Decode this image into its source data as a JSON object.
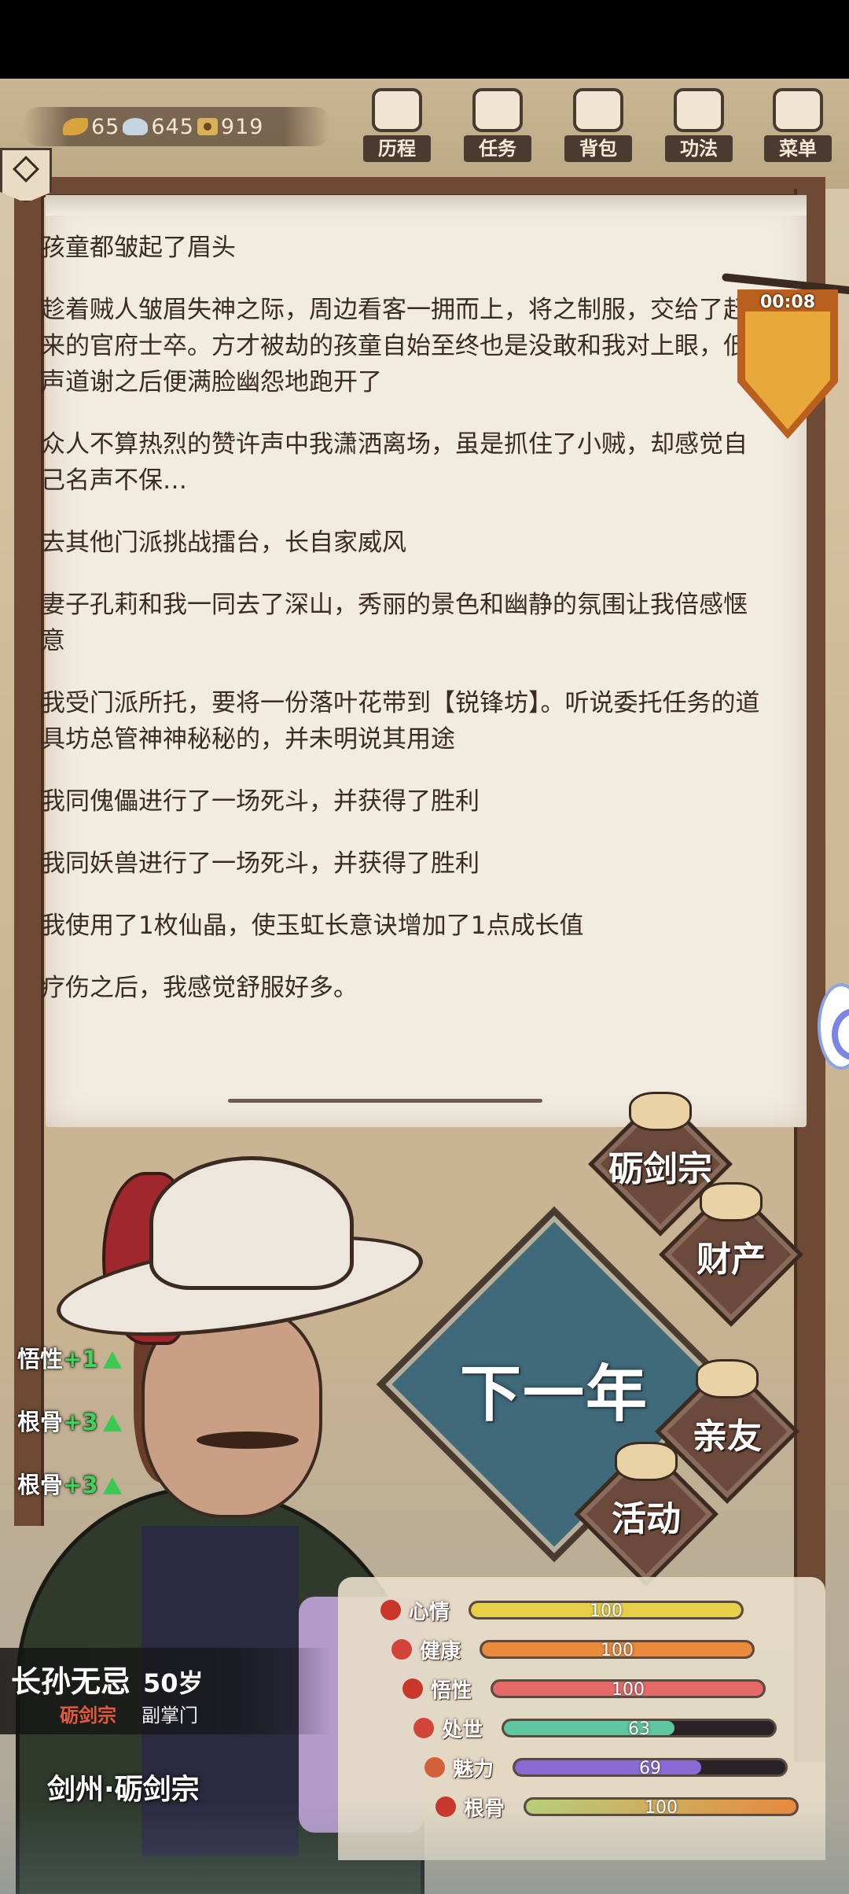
{
  "currency": [
    {
      "icon": "leaf-icon",
      "value": "65"
    },
    {
      "icon": "cloud-icon",
      "value": "645"
    },
    {
      "icon": "coin-icon",
      "value": "919"
    }
  ],
  "menu": [
    {
      "name": "history",
      "label": "历程",
      "icon": "gourd-icon"
    },
    {
      "name": "tasks",
      "label": "任务",
      "icon": "scroll-icon"
    },
    {
      "name": "bag",
      "label": "背包",
      "icon": "bag-icon"
    },
    {
      "name": "skills",
      "label": "功法",
      "icon": "book-icon"
    },
    {
      "name": "menu",
      "label": "菜单",
      "icon": "fan-icon"
    }
  ],
  "timer": "00:08",
  "log": [
    "孩童都皱起了眉头",
    "趁着贼人皱眉失神之际，周边看客一拥而上，将之制服，交给了赶来的官府士卒。方才被劫的孩童自始至终也是没敢和我对上眼，低声道谢之后便满脸幽怨地跑开了",
    "众人不算热烈的赞许声中我潇洒离场，虽是抓住了小贼，却感觉自己名声不保…",
    "去其他门派挑战擂台，长自家威风",
    "妻子孔莉和我一同去了深山，秀丽的景色和幽静的氛围让我倍感惬意",
    "我受门派所托，要将一份落叶花带到【锐锋坊】。听说委托任务的道具坊总管神神秘秘的，并未明说其用途",
    "我同傀儡进行了一场死斗，并获得了胜利",
    "我同妖兽进行了一场死斗，并获得了胜利",
    "我使用了1枚仙晶，使玉虹长意诀增加了1点成长值",
    "疗伤之后，我感觉舒服好多。"
  ],
  "buffs": [
    {
      "name": "悟性",
      "delta": "+1"
    },
    {
      "name": "根骨",
      "delta": "+3"
    },
    {
      "name": "根骨",
      "delta": "+3"
    }
  ],
  "actions": {
    "next_year": "下一年",
    "sect": "砺剑宗",
    "assets": "财产",
    "family": "亲友",
    "activity": "活动"
  },
  "character": {
    "name": "长孙无忌",
    "age": "50岁",
    "sect": "砺剑宗",
    "rank": "副掌门",
    "location": "剑州·砺剑宗"
  },
  "stats": [
    {
      "name": "心情",
      "value": "100",
      "ratio": 1.0,
      "color": "#e6d04a",
      "icon_color": "#c9362a"
    },
    {
      "name": "健康",
      "value": "100",
      "ratio": 1.0,
      "color": "#e98a3c",
      "icon_color": "#d2443a"
    },
    {
      "name": "悟性",
      "value": "100",
      "ratio": 1.0,
      "color": "#e46a6a",
      "icon_color": "#c9362a"
    },
    {
      "name": "处世",
      "value": "63",
      "ratio": 0.63,
      "color": "#5fc7a0",
      "icon_color": "#d2443a"
    },
    {
      "name": "魅力",
      "value": "69",
      "ratio": 0.69,
      "color": "#8a6ad4",
      "icon_color": "#d2603a"
    },
    {
      "name": "根骨",
      "value": "100",
      "ratio": 1.0,
      "color": "#d7c26a",
      "icon_color": "#c9362a"
    }
  ]
}
